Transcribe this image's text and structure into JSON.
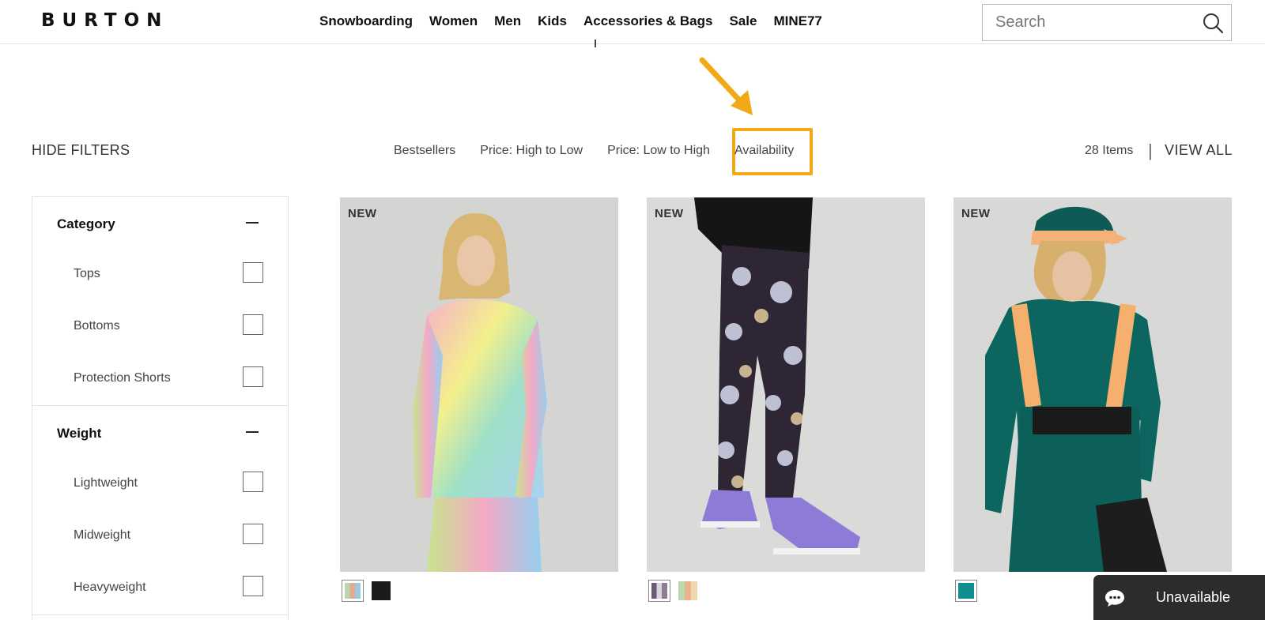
{
  "header": {
    "logo": "BURTON",
    "nav": [
      "Snowboarding",
      "Women",
      "Men",
      "Kids",
      "Accessories & Bags",
      "Sale",
      "MINE77"
    ],
    "search_placeholder": "Search"
  },
  "sort_bar": {
    "hide_filters": "HIDE FILTERS",
    "options": [
      "Bestsellers",
      "Price: High to Low",
      "Price: Low to High",
      "Availability"
    ],
    "highlighted_option": "Availability",
    "items_count": "28 Items",
    "divider": "|",
    "view_all": "VIEW ALL"
  },
  "filters": [
    {
      "title": "Category",
      "options": [
        "Tops",
        "Bottoms",
        "Protection Shorts"
      ]
    },
    {
      "title": "Weight",
      "options": [
        "Lightweight",
        "Midweight",
        "Heavyweight"
      ]
    }
  ],
  "products": [
    {
      "badge": "NEW",
      "image": "woman-in-gradient-base-layer",
      "swatches": [
        "#cfe3c8",
        "#1a1a1a"
      ]
    },
    {
      "badge": "NEW",
      "image": "floral-leggings-and-purple-shoes",
      "swatches": [
        "#7a6a80",
        "#e7b98f"
      ]
    },
    {
      "badge": "NEW",
      "image": "woman-in-teal-top-and-bibs",
      "swatches": [
        "#0f8f90"
      ]
    }
  ],
  "chat": {
    "label": "Unavailable"
  },
  "colors": {
    "annotation": "#f2a918",
    "chat_bg": "#2c2c2c"
  }
}
